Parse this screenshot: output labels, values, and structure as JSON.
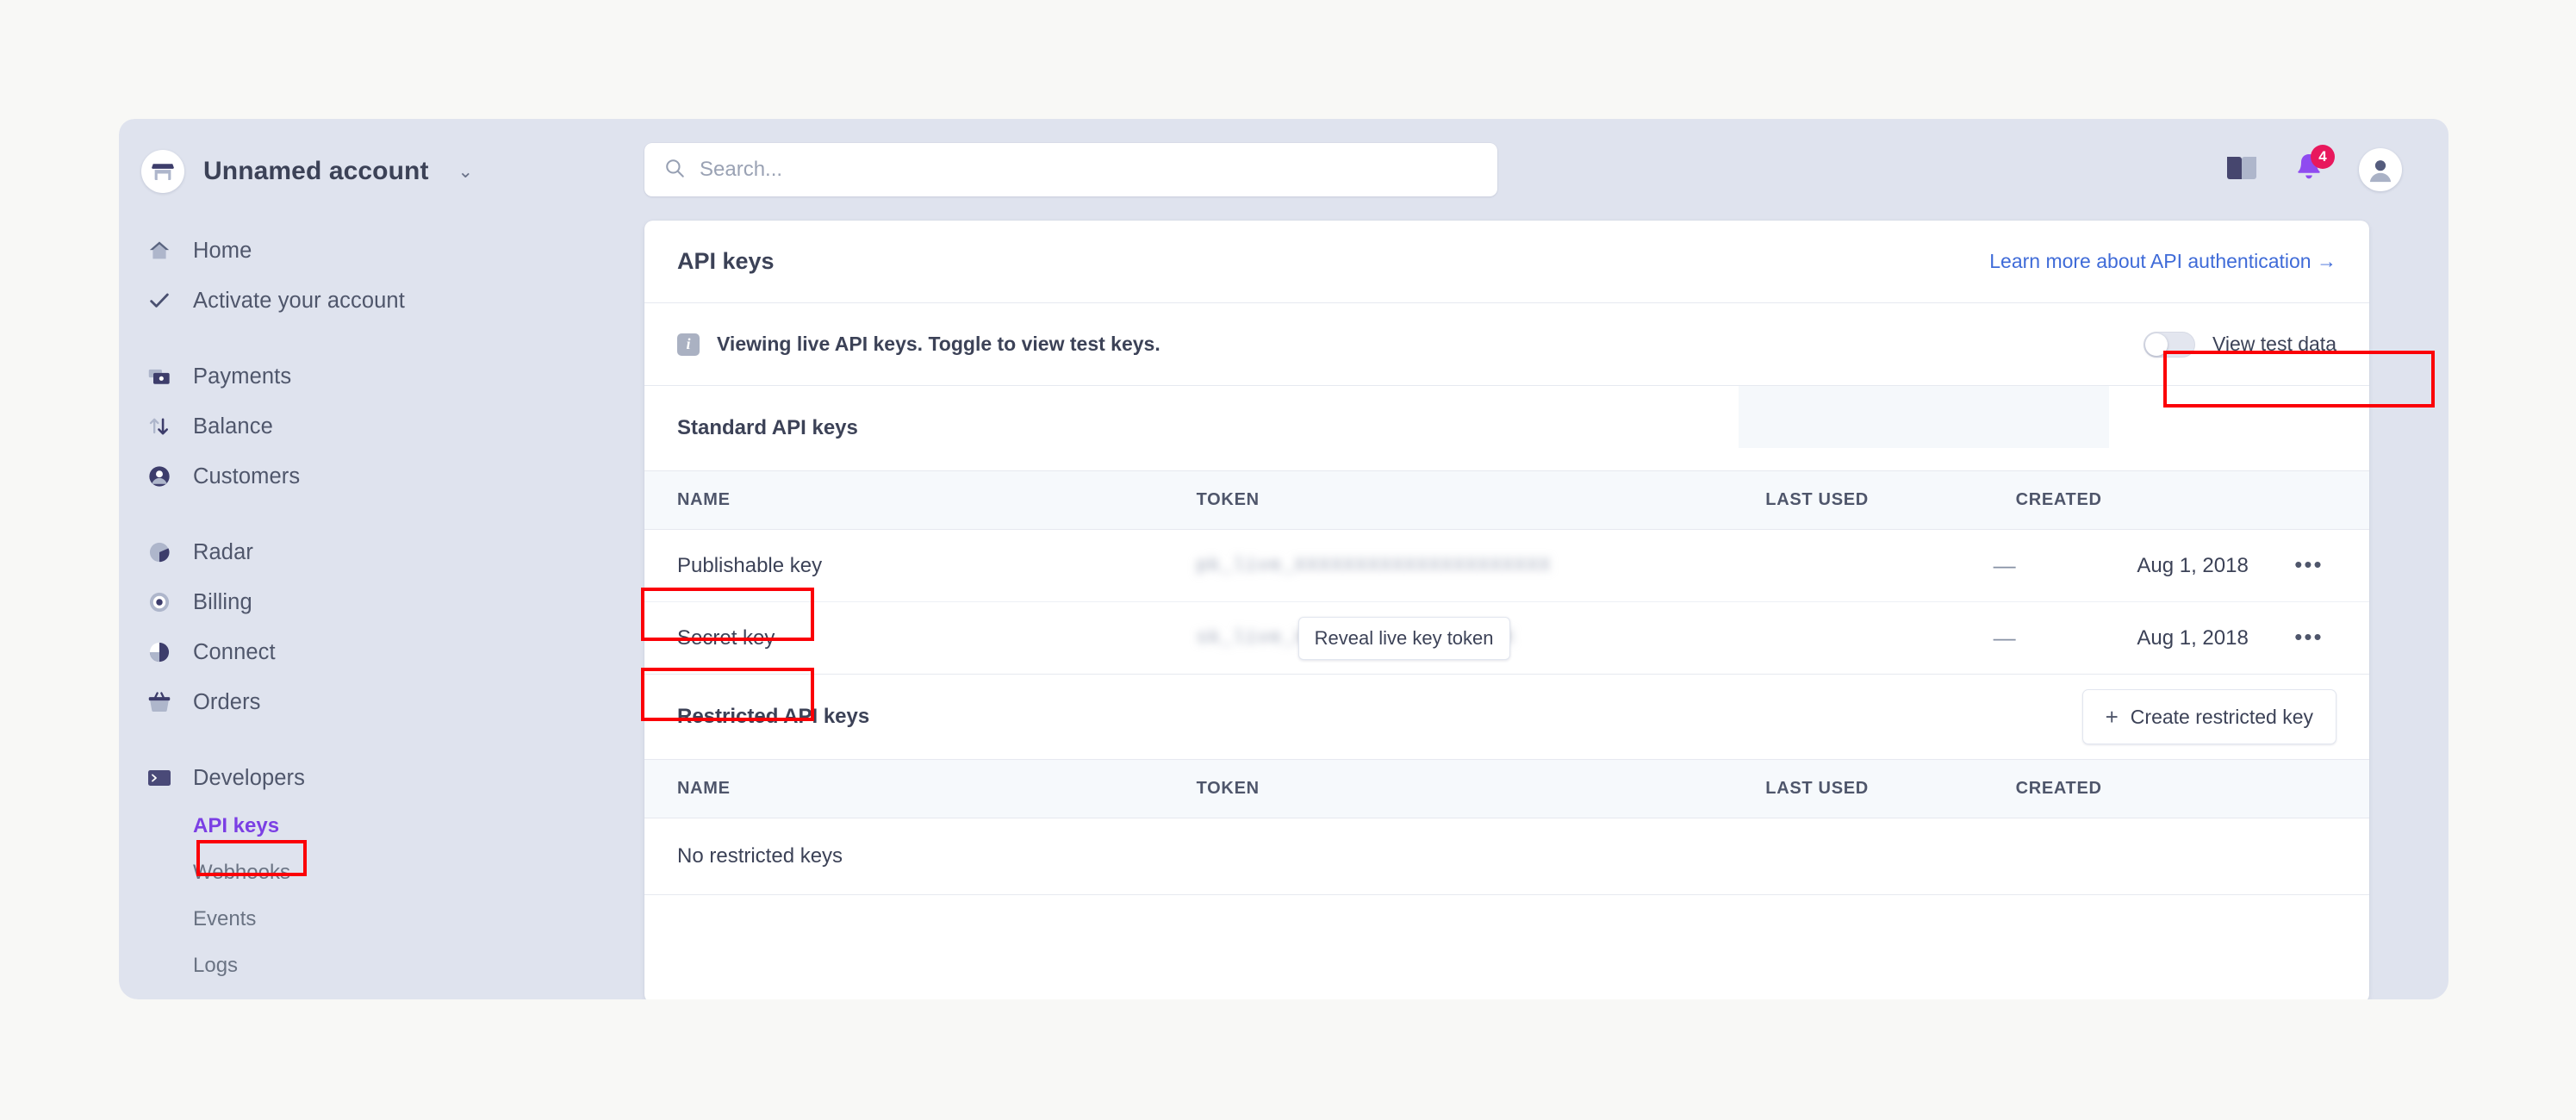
{
  "sidebar": {
    "account": {
      "name": "Unnamed account",
      "chevron": "chevron-down-icon"
    },
    "groups": [
      {
        "items": [
          {
            "label": "Home",
            "icon": "home-icon"
          },
          {
            "label": "Activate your account",
            "icon": "check-icon"
          }
        ]
      },
      {
        "items": [
          {
            "label": "Payments",
            "icon": "payments-icon"
          },
          {
            "label": "Balance",
            "icon": "balance-icon"
          },
          {
            "label": "Customers",
            "icon": "customers-icon"
          }
        ]
      },
      {
        "items": [
          {
            "label": "Radar",
            "icon": "radar-icon"
          },
          {
            "label": "Billing",
            "icon": "billing-icon"
          },
          {
            "label": "Connect",
            "icon": "connect-icon"
          },
          {
            "label": "Orders",
            "icon": "orders-icon"
          }
        ]
      },
      {
        "items": [
          {
            "label": "Developers",
            "icon": "terminal-icon"
          }
        ]
      }
    ],
    "developer_subitems": [
      {
        "label": "API keys",
        "active": true
      },
      {
        "label": "Webhooks",
        "active": false
      },
      {
        "label": "Events",
        "active": false
      },
      {
        "label": "Logs",
        "active": false
      }
    ]
  },
  "topbar": {
    "search": {
      "placeholder": "Search...",
      "value": "",
      "icon": "search-icon"
    },
    "docs_icon": "book-icon",
    "notifications": {
      "icon": "bell-icon",
      "count": "4"
    },
    "avatar": "user-avatar-icon"
  },
  "main": {
    "title": "API keys",
    "learn_more": "Learn more about API authentication →",
    "banner": {
      "icon": "info-icon",
      "text": "Viewing live API keys. Toggle to view test keys.",
      "toggle_label": "View test data",
      "toggle_on": false
    },
    "standard": {
      "section_title": "Standard API keys",
      "columns": [
        "NAME",
        "TOKEN",
        "LAST USED",
        "CREATED"
      ],
      "rows": [
        {
          "name": "Publishable key",
          "token": "pk_live_XXXXXXXXXXXXXXXXXXXXX",
          "last_used": "—",
          "created": "Aug 1, 2018",
          "actions": "•••",
          "reveal_button": null
        },
        {
          "name": "Secret key",
          "token": "sk_live_XXXXXXXXXXXXXXXXXX",
          "last_used": "—",
          "created": "Aug 1, 2018",
          "actions": "•••",
          "reveal_button": "Reveal live key token"
        }
      ]
    },
    "restricted": {
      "section_title": "Restricted API keys",
      "create_button": "Create restricted key",
      "create_icon": "plus-icon",
      "columns": [
        "NAME",
        "TOKEN",
        "LAST USED",
        "CREATED"
      ],
      "empty_text": "No restricted keys"
    }
  },
  "colors": {
    "page_background": "#f8f8f6",
    "sidebar_background": "#dfe3ee",
    "accent_active": "#7b3fe4",
    "link": "#3f6bd8",
    "badge": "#e8185d",
    "annotation": "#fb0007",
    "text_primary": "#3c4257",
    "text_secondary": "#6a7383"
  }
}
